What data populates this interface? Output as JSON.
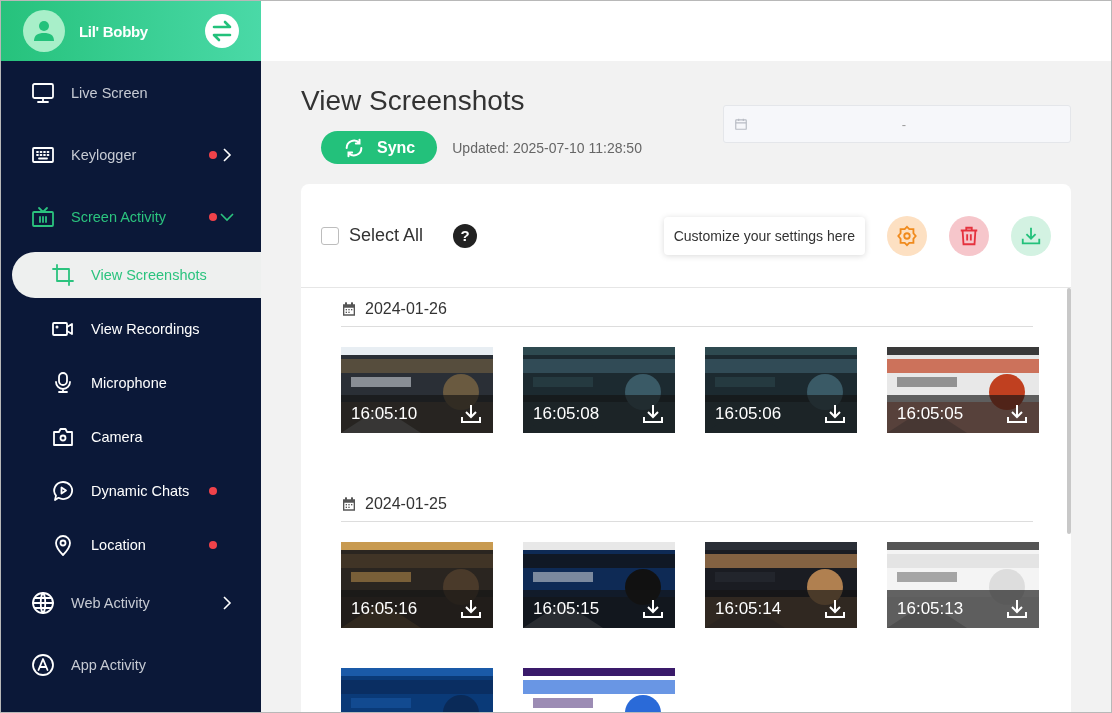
{
  "sidebar": {
    "user": {
      "name": "Lil' Bobby"
    },
    "items": [
      {
        "label": "Live Screen",
        "selected": false
      },
      {
        "label": "Keylogger",
        "selected": false,
        "alert": true,
        "expanded": false
      },
      {
        "label": "Screen Activity",
        "selected": true,
        "alert": true,
        "expanded": true,
        "children": [
          {
            "label": "View Screenshots",
            "selected": true
          },
          {
            "label": "View Recordings",
            "selected": false
          },
          {
            "label": "Microphone",
            "selected": false
          },
          {
            "label": "Camera",
            "selected": false
          },
          {
            "label": "Dynamic Chats",
            "selected": false,
            "alert": true
          },
          {
            "label": "Location",
            "selected": false,
            "alert": true
          }
        ]
      },
      {
        "label": "Web Activity",
        "selected": false,
        "expanded": false
      },
      {
        "label": "App Activity",
        "selected": false
      }
    ]
  },
  "page": {
    "title": "View Screenshots",
    "sync_button": "Sync",
    "updated": "Updated: 2025-07-10 11:28:50",
    "date_range": {
      "separator": "-"
    }
  },
  "card": {
    "select_all": {
      "label": "Select All",
      "checked": false
    },
    "help": "?",
    "tooltip": "Customize your settings here",
    "actions": [
      {
        "kind": "settings"
      },
      {
        "kind": "delete"
      },
      {
        "kind": "download"
      }
    ],
    "groups": [
      {
        "date": "2024-01-26",
        "shots": [
          {
            "kind": "picture",
            "time": "16:05:10"
          },
          {
            "kind": "picture",
            "time": "16:05:08"
          },
          {
            "kind": "picture",
            "time": "16:05:06"
          },
          {
            "kind": "picture",
            "time": "16:05:05"
          }
        ]
      },
      {
        "date": "2024-01-25",
        "shots": [
          {
            "kind": "picture",
            "time": "16:05:16"
          },
          {
            "kind": "picture",
            "time": "16:05:15"
          },
          {
            "kind": "picture",
            "time": "16:05:14"
          },
          {
            "kind": "picture",
            "time": "16:05:13"
          },
          {
            "kind": "picture"
          },
          {
            "kind": "picture"
          }
        ]
      }
    ]
  }
}
